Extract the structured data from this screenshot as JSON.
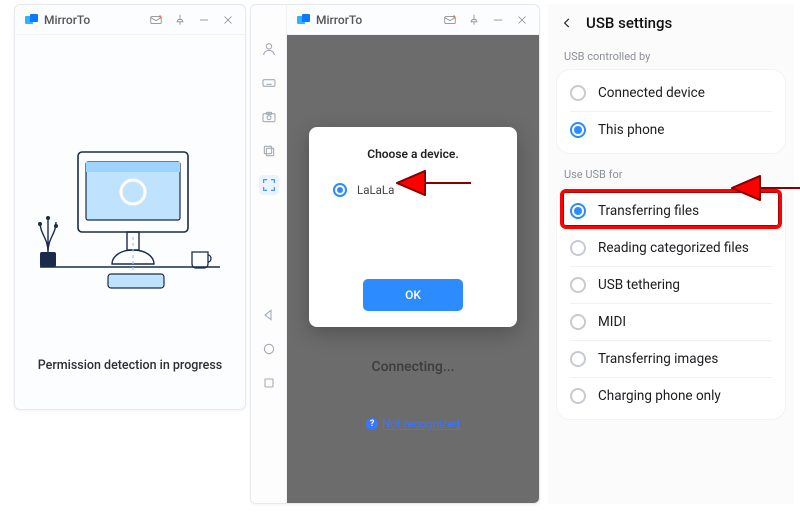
{
  "panel1": {
    "app_title": "MirrorTo",
    "status_text": "Permission detection in progress"
  },
  "panel2": {
    "app_title": "MirrorTo",
    "sidebar_icons": [
      "user",
      "keyboard",
      "camera",
      "layers",
      "fullscreen",
      "back",
      "circle",
      "square"
    ],
    "dialog_title": "Choose a device.",
    "device_name": "LaLaLa",
    "ok_label": "OK",
    "connecting_label": "Connecting...",
    "not_recognized_label": "Not recognized"
  },
  "panel3": {
    "title": "USB settings",
    "group1_label": "USB controlled by",
    "group1_options": [
      "Connected device",
      "This phone"
    ],
    "group1_selected": 1,
    "group2_label": "Use USB for",
    "group2_options": [
      "Transferring files",
      "Reading categorized files",
      "USB tethering",
      "MIDI",
      "Transferring images",
      "Charging phone only"
    ],
    "group2_selected": 0
  }
}
